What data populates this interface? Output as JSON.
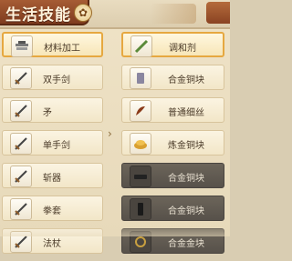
{
  "header": {
    "title": "生活技能"
  },
  "left_list": [
    {
      "label": "材料加工",
      "icon": "tools-icon",
      "selected": true
    },
    {
      "label": "双手剑",
      "icon": "sword-icon"
    },
    {
      "label": "矛",
      "icon": "sword-icon"
    },
    {
      "label": "单手剑",
      "icon": "sword-icon"
    },
    {
      "label": "斩器",
      "icon": "sword-icon"
    },
    {
      "label": "拳套",
      "icon": "sword-icon"
    },
    {
      "label": "法杖",
      "icon": "sword-icon"
    }
  ],
  "right_list": [
    {
      "label": "调和剂",
      "icon": "vial-icon",
      "selected": true
    },
    {
      "label": "合金铜块",
      "icon": "ingot-icon"
    },
    {
      "label": "普通细丝",
      "icon": "thread-icon"
    },
    {
      "label": "炼金铜块",
      "icon": "gold-pile-icon"
    },
    {
      "label": "合金铜块",
      "icon": "dark-ingot-icon",
      "disabled": true
    },
    {
      "label": "合金铜块",
      "icon": "dark-bar-icon",
      "disabled": true
    },
    {
      "label": "合金金块",
      "icon": "ring-icon",
      "disabled": true
    }
  ]
}
